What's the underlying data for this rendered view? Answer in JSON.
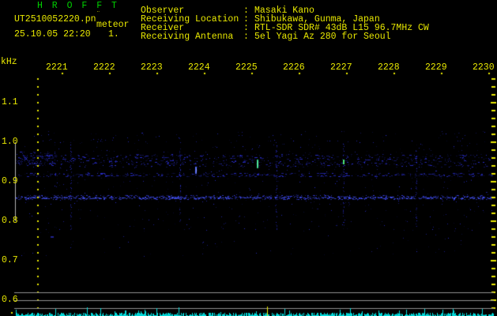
{
  "header": {
    "app_title": "H R O F F T",
    "filename": "UT2510052220.pn",
    "filename_clip_mark": "¨",
    "station": "meteor",
    "datetime": "25.10.05 22:20",
    "counter": "1.",
    "colon": ":",
    "info": [
      {
        "label": "Observer",
        "value": "Masaki Kano"
      },
      {
        "label": "Receiving Location",
        "value": "Shibukawa, Gunma, Japan"
      },
      {
        "label": "Receiver",
        "value": "RTL-SDR SDR# 43dB L15 96.7MHz CW"
      },
      {
        "label": "Receiving Antenna",
        "value": "5el Yagi Az 280 for Seoul"
      }
    ]
  },
  "colors": {
    "background": "#000000",
    "text_yellow": "#e8e800",
    "title_green": "#00d000",
    "noise_blue": "#282cc8",
    "carrier_blue": "#4655f0",
    "level_cyan": "#00d9d9",
    "grid_gray": "#909090",
    "marker_gray": "#b4b4b4"
  },
  "chart_data": {
    "type": "heatmap",
    "title": "HROFFT radio meteor echo spectrogram, 10-minute frame",
    "x_axis_description": "UT time hhmm from 22:20 to 22:30",
    "x_ticks": [
      "2221",
      "2222",
      "2223",
      "2224",
      "2225",
      "2226",
      "2227",
      "2228",
      "2229",
      "2230"
    ],
    "y_unit_label": "kHz",
    "y_ticks": [
      "1.1",
      "1.0",
      "0.9",
      "0.8",
      "0.7",
      "0.6"
    ],
    "y_range_khz": [
      0.58,
      1.16
    ],
    "grid": "off",
    "measure_range_marker_khz": [
      0.8,
      1.0
    ],
    "noise_features": {
      "speckle_band_khz": [
        0.78,
        1.0
      ],
      "broad_band_khz": [
        0.93,
        0.97
      ],
      "secondary_line_khz": 0.92,
      "carrier_line_khz": 0.86,
      "interference_column_times": [
        "2221:10",
        "2223:27",
        "2225:28",
        "2226:52",
        "2228:24"
      ]
    },
    "echo_events": [
      {
        "time": "2223:46",
        "khz": 0.93,
        "color": "#5a6eff"
      },
      {
        "time": "2225:03",
        "khz": 0.95,
        "color": "#3cdc96"
      },
      {
        "time": "2226:51",
        "khz": 0.955,
        "color": "#50f078"
      }
    ],
    "level_strip": {
      "description": "received signal level trace along bottom",
      "color": "#00d9d9",
      "gridline_color": "#909090",
      "marker_time": "2225:16",
      "marker_color": "#e8e800"
    }
  }
}
